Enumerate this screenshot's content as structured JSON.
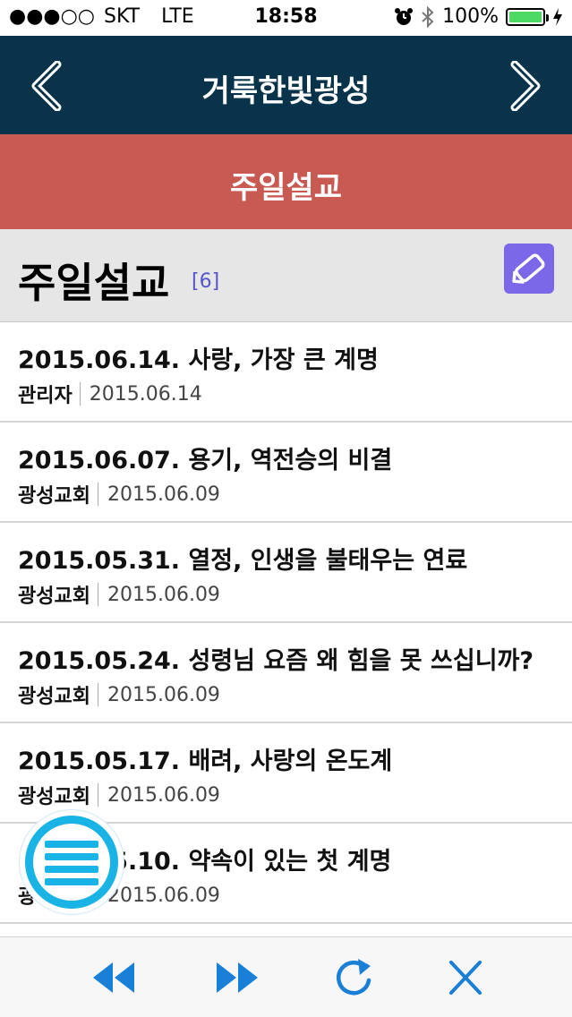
{
  "status_bar": {
    "signal": "●●●○○",
    "carrier": "SKT",
    "network": "LTE",
    "time": "18:58",
    "battery": "100%",
    "battery_level": 1.0
  },
  "nav": {
    "title": "거룩한빛광성",
    "back_icon": "chevron-left-icon",
    "forward_icon": "chevron-right-icon"
  },
  "section": {
    "title": "주일설교"
  },
  "board": {
    "title": "주일설교",
    "count": "[6]",
    "write_icon": "pencil-icon"
  },
  "posts": [
    {
      "title": "2015.06.14. 사랑, 가장 큰 계명",
      "author": "관리자",
      "date": "2015.06.14"
    },
    {
      "title": "2015.06.07. 용기, 역전승의 비결",
      "author": "광성교회",
      "date": "2015.06.09"
    },
    {
      "title": "2015.05.31. 열정, 인생을 불태우는 연료",
      "author": "광성교회",
      "date": "2015.06.09"
    },
    {
      "title": "2015.05.24. 성령님 요즘 왜 힘을 못 쓰십니까?",
      "author": "광성교회",
      "date": "2015.06.09"
    },
    {
      "title": "2015.05.17. 배려, 사랑의 온도계",
      "author": "광성교회",
      "date": "2015.06.09"
    },
    {
      "title": "2015.05.10. 약속이 있는 첫 계명",
      "author": "광성교회",
      "date": "2015.06.09"
    }
  ],
  "toolbar": {
    "rewind_icon": "rewind-icon",
    "fast_forward_icon": "fast-forward-icon",
    "refresh_icon": "refresh-icon",
    "close_icon": "close-icon"
  },
  "colors": {
    "nav_bg": "#08334a",
    "banner_bg": "#c85a52",
    "accent_blue": "#1a7fd6",
    "fab_ring": "#19b3e6",
    "write_btn": "#7b68e8"
  }
}
